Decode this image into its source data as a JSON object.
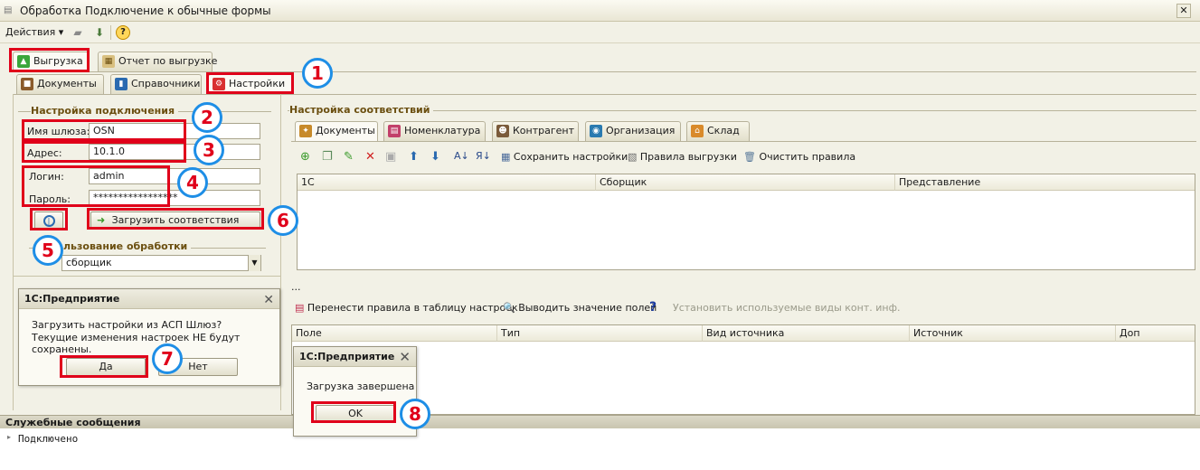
{
  "window": {
    "title": "Обработка  Подключение к обычные формы",
    "close": "✕"
  },
  "menu": {
    "actions": "Действия",
    "help_icon": "?"
  },
  "top_tabs": [
    {
      "label": "Выгрузка",
      "icon": "upload-icon"
    },
    {
      "label": "Отчет по выгрузке",
      "icon": "report-icon"
    }
  ],
  "sub_tabs": [
    {
      "label": "Документы",
      "icon": "briefcase-icon"
    },
    {
      "label": "Справочники",
      "icon": "book-icon"
    },
    {
      "label": "Настройки",
      "icon": "settings-icon"
    }
  ],
  "connection": {
    "title": "Настройка подключения",
    "gateway_label": "Имя шлюза:",
    "gateway_value": "OSN",
    "address_label": "Адрес:",
    "address_value": "10.1.0",
    "login_label": "Логин:",
    "login_value": "admin",
    "password_label": "Пароль:",
    "password_value": "*****************",
    "load_button": "Загрузить соответствия"
  },
  "usage": {
    "title_visible": "льзование обработки",
    "select_value": "сборщик"
  },
  "mapping": {
    "title": "Настройка соответствий",
    "tabs": [
      {
        "label": "Документы",
        "icon": "docs-icon"
      },
      {
        "label": "Номенклатура",
        "icon": "nomenclature-icon"
      },
      {
        "label": "Контрагент",
        "icon": "partner-icon"
      },
      {
        "label": "Организация",
        "icon": "organization-icon"
      },
      {
        "label": "Склад",
        "icon": "warehouse-icon"
      }
    ],
    "toolbar": {
      "save_settings": "Сохранить настройки",
      "export_rules": "Правила выгрузки",
      "clear_rules": "Очистить правила"
    },
    "columns": [
      "1С",
      "Сборщик",
      "Представление"
    ],
    "ellipsis": "...",
    "toolbar2": {
      "transfer_rules": "Перенести правила в таблицу настроек",
      "show_fields": "Выводить значение полей",
      "set_contact_types": "Установить используемые виды конт. инф."
    },
    "columns2": [
      "Поле",
      "Тип",
      "Вид источника",
      "Источник",
      "Доп"
    ]
  },
  "dialog1": {
    "title": "1С:Предприятие",
    "line1": "Загрузить настройки из АСП Шлюз?",
    "line2": "Текущие изменения настроек НЕ будут сохранены.",
    "yes": "Да",
    "no": "Нет"
  },
  "dialog2": {
    "title": "1С:Предприятие",
    "message": "Загрузка завершена",
    "ok": "OK"
  },
  "messages": {
    "title": "Служебные сообщения",
    "line": "Подключено"
  },
  "markers": [
    "1",
    "2",
    "3",
    "4",
    "5",
    "6",
    "7",
    "8"
  ],
  "colors": {
    "highlight": "#e0001a",
    "marker_ring": "#1e8ee6"
  }
}
